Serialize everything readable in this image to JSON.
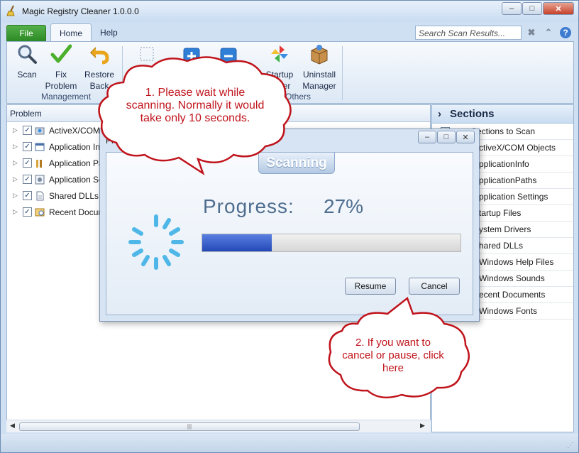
{
  "window": {
    "title": "Magic Registry Cleaner 1.0.0.0"
  },
  "tabs": {
    "file": "File",
    "home": "Home",
    "help": "Help"
  },
  "search": {
    "placeholder": "Search Scan Results..."
  },
  "ribbon": {
    "scan": "Scan",
    "fix_line1": "Fix",
    "fix_line2": "Problem",
    "restore_line1": "Restore",
    "restore_line2": "Back",
    "startup_line1": "Startup",
    "startup_line2": "nager",
    "uninstall_line1": "Uninstall",
    "uninstall_line2": "Manager",
    "group_management": "Management",
    "group_others": "Others"
  },
  "problems": {
    "header": "Problem",
    "rows": [
      "ActiveX/COM Ob",
      "Application Info",
      "Application Pat",
      "Application Set",
      "Shared DLLs (",
      "Recent Docume"
    ]
  },
  "sections": {
    "header": "Sections",
    "items": [
      "Sections to Scan",
      "ctiveX/COM Objects",
      "pplicationInfo",
      "pplicationPaths",
      "pplication Settings",
      "tartup Files",
      "ystem Drivers",
      "hared DLLs",
      "Windows Help Files",
      "Windows Sounds",
      "ecent Documents",
      "Windows Fonts"
    ]
  },
  "dialog": {
    "title": "Progress",
    "banner": "Scanning",
    "progress_label": "Progress:",
    "progress_pct": "27%",
    "progress_value": 0.27,
    "resume": "Resume",
    "cancel": "Cancel"
  },
  "callouts": {
    "one_l1": "1. Please wait while",
    "one_l2": "scanning. Normally it would",
    "one_l3": "take only 10 seconds.",
    "two_l1": "2. If you want to",
    "two_l2": "cancel or pause, click",
    "two_l3": "here"
  },
  "colors": {
    "accent": "#2c8a25",
    "progress": "#2349b8",
    "callout": "#c0141c"
  }
}
